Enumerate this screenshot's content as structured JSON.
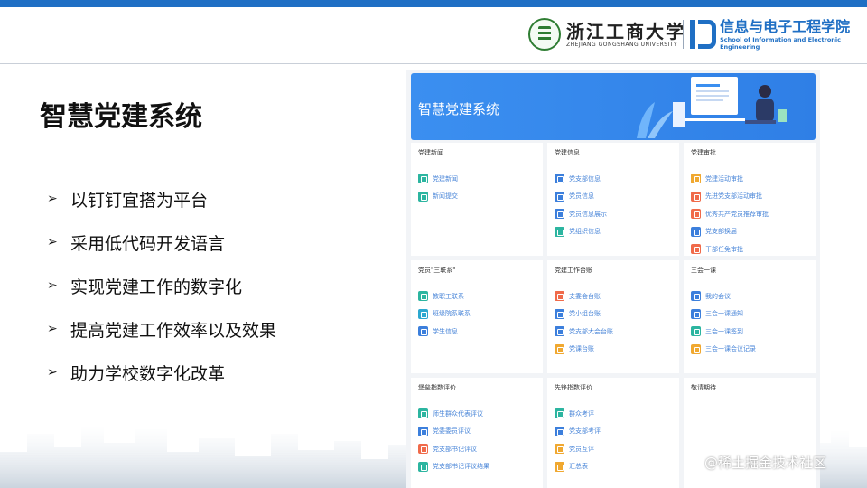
{
  "header": {
    "school_cn": "浙江工商大学",
    "school_en": "ZHEJIANG GONGSHANG UNIVERSITY",
    "college_cn": "信息与电子工程学院",
    "college_en": "School of Information and Electronic Engineering"
  },
  "slide": {
    "title": "智慧党建系统",
    "bullets": [
      "以钉钉宜搭为平台",
      "采用低代码开发语言",
      "实现党建工作的数字化",
      "提高党建工作效率以及效果",
      "助力学校数字化改革"
    ]
  },
  "app": {
    "banner_title": "智慧党建系统",
    "cards": [
      {
        "title": "党建新闻",
        "items": [
          {
            "label": "党建新闻",
            "color": "#2cb5a0"
          },
          {
            "label": "新闻提交",
            "color": "#2cb5a0"
          }
        ]
      },
      {
        "title": "党建信息",
        "items": [
          {
            "label": "党支部信息",
            "color": "#3c7fdc"
          },
          {
            "label": "党员信息",
            "color": "#3c7fdc"
          },
          {
            "label": "党员信息展示",
            "color": "#3c7fdc"
          },
          {
            "label": "党组织信息",
            "color": "#2cb5a0"
          }
        ]
      },
      {
        "title": "党建审批",
        "items": [
          {
            "label": "党建活动审批",
            "color": "#f0a830"
          },
          {
            "label": "先进党支部活动审批",
            "color": "#f06a4a"
          },
          {
            "label": "优秀共产党员推荐审批",
            "color": "#f06a4a"
          },
          {
            "label": "党支部换届",
            "color": "#3c7fdc"
          },
          {
            "label": "干部任免审批",
            "color": "#f06a4a"
          }
        ]
      },
      {
        "title": "党员\"三联系\"",
        "items": [
          {
            "label": "教职工联系",
            "color": "#2cb5a0"
          },
          {
            "label": "班级院系联系",
            "color": "#2ca8d0"
          },
          {
            "label": "学生信息",
            "color": "#3c7fdc"
          }
        ]
      },
      {
        "title": "党建工作台账",
        "items": [
          {
            "label": "支委会台账",
            "color": "#f06a4a"
          },
          {
            "label": "党小组台账",
            "color": "#3c7fdc"
          },
          {
            "label": "党支部大会台账",
            "color": "#3c7fdc"
          },
          {
            "label": "党课台账",
            "color": "#f0a830"
          }
        ]
      },
      {
        "title": "三会一课",
        "items": [
          {
            "label": "我的会议",
            "color": "#3c7fdc"
          },
          {
            "label": "三会一课通知",
            "color": "#3c7fdc"
          },
          {
            "label": "三会一课签到",
            "color": "#2cb5a0"
          },
          {
            "label": "三会一课会议记录",
            "color": "#f0a830"
          }
        ]
      },
      {
        "title": "堡垒指数评价",
        "items": [
          {
            "label": "师生群众代表评议",
            "color": "#2cb5a0"
          },
          {
            "label": "党委委员评议",
            "color": "#3c7fdc"
          },
          {
            "label": "党支部书记评议",
            "color": "#f06a4a"
          },
          {
            "label": "党支部书记评议结果",
            "color": "#2cb5a0"
          }
        ]
      },
      {
        "title": "先锋指数评价",
        "items": [
          {
            "label": "群众考评",
            "color": "#2cb5a0"
          },
          {
            "label": "党支部考评",
            "color": "#3c7fdc"
          },
          {
            "label": "党员互评",
            "color": "#f0a830"
          },
          {
            "label": "汇总表",
            "color": "#f0a830"
          }
        ]
      },
      {
        "title": "敬请期待",
        "items": []
      }
    ]
  },
  "watermark": "@稀土掘金技术社区"
}
